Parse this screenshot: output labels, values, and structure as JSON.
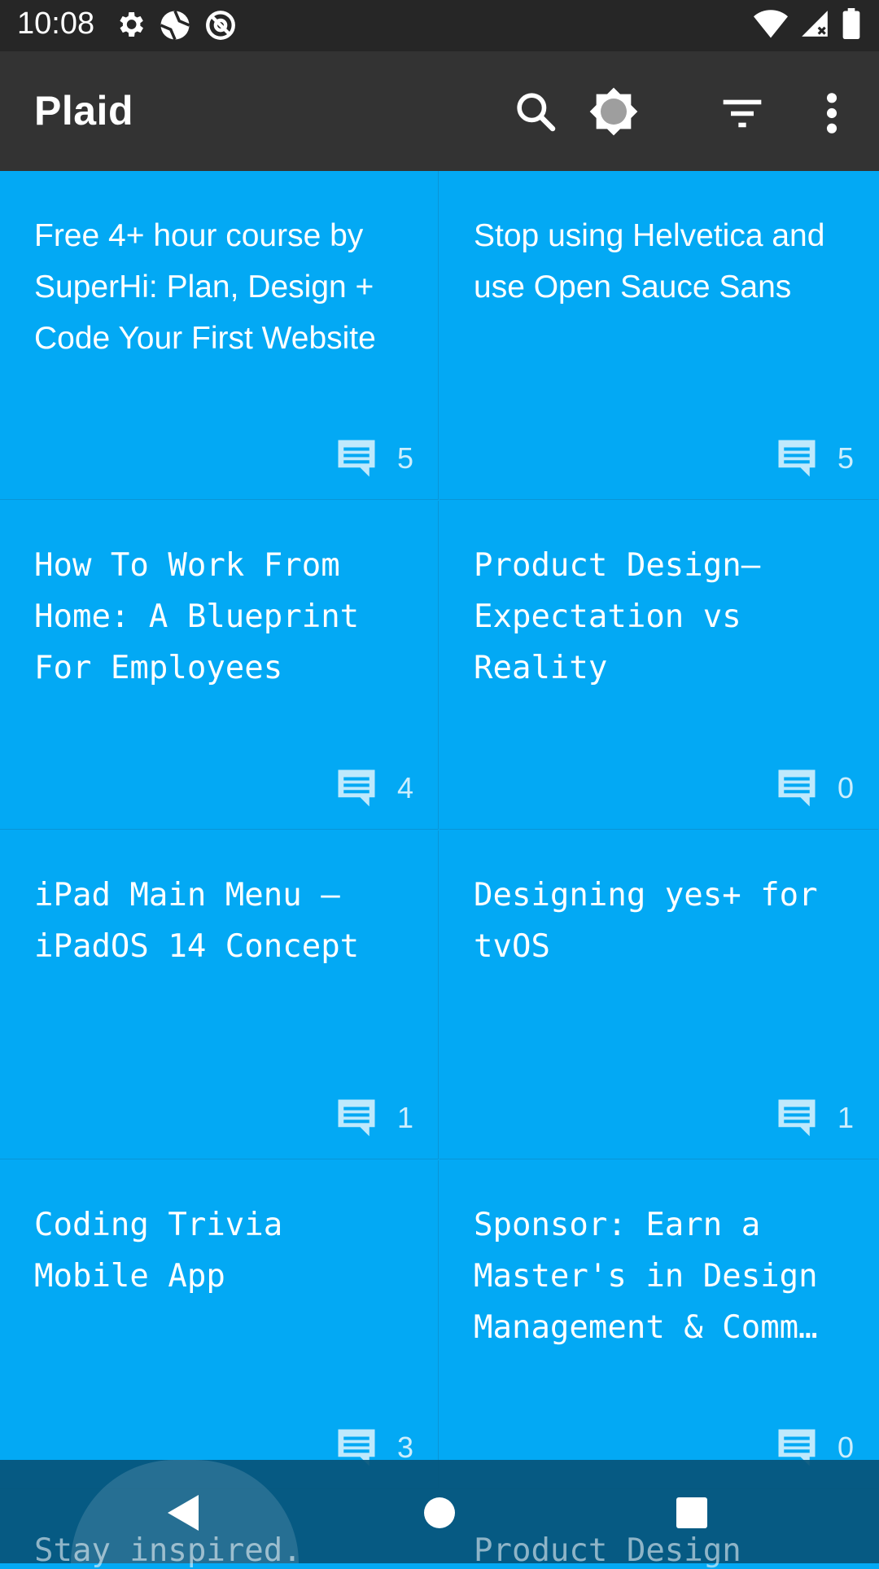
{
  "status_bar": {
    "time": "10:08",
    "icons_left": [
      "settings-icon",
      "camera-aperture-icon",
      "at-sign-icon"
    ],
    "icons_right": [
      "wifi-icon",
      "signal-icon",
      "battery-icon"
    ]
  },
  "app_bar": {
    "title": "Plaid",
    "actions": [
      "search-icon",
      "brightness-icon",
      "filter-icon",
      "more-vert-icon"
    ]
  },
  "cards": [
    {
      "title": "Free 4+ hour course by SuperHi: Plan, Design + Code Your First Website",
      "comments": "5",
      "font": "sans"
    },
    {
      "title": "Stop using Helvetica and use Open Sauce Sans",
      "comments": "5",
      "font": "sans"
    },
    {
      "title": "How To Work From Home: A Blueprint For Employees",
      "comments": "4",
      "font": "mono"
    },
    {
      "title": "Product Design—Expectation vs Reality",
      "comments": "0",
      "font": "mono"
    },
    {
      "title": "iPad Main Menu — iPadOS 14 Concept",
      "comments": "1",
      "font": "mono"
    },
    {
      "title": "Designing yes+ for tvOS",
      "comments": "1",
      "font": "mono"
    },
    {
      "title": "Coding Trivia Mobile App",
      "comments": "3",
      "font": "mono"
    },
    {
      "title": "Sponsor: Earn a Master's in Design Management & Comm…",
      "comments": "0",
      "font": "mono"
    }
  ],
  "peek": [
    "Stay inspired.",
    "Product Design"
  ],
  "nav_bar": {
    "buttons": [
      "back-icon",
      "home-icon",
      "recents-icon"
    ]
  },
  "colors": {
    "card_bg": "#03a9f4",
    "app_bar": "#333333",
    "status_bar": "#262626"
  }
}
